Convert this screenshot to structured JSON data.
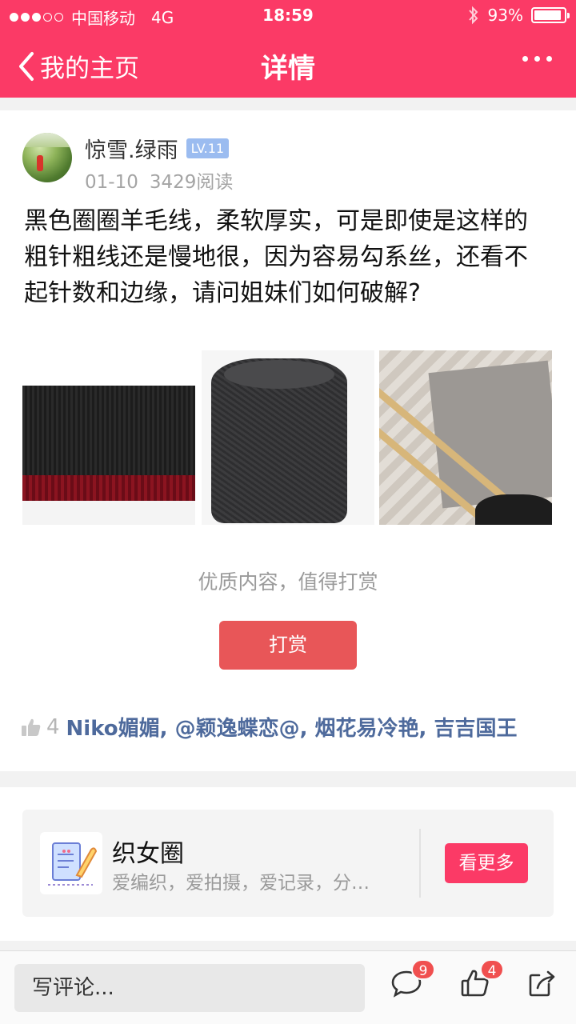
{
  "status_bar": {
    "carrier": "中国移动",
    "network": "4G",
    "time": "18:59",
    "battery": "93%",
    "battery_level": 0.93
  },
  "nav": {
    "back_label": "我的主页",
    "title": "详情"
  },
  "post": {
    "author": "惊雪.绿雨",
    "level": "LV.11",
    "date": "01-10",
    "reads": "3429阅读",
    "content": "黑色圈圈羊毛线，柔软厚实，可是即使是这样的粗针粗线还是慢地很，因为容易勾系丝，还看不起针数和边缘，请问姐妹们如何破解?",
    "reward_prompt": "优质内容，值得打赏",
    "reward_button": "打赏",
    "likes_count": "4",
    "likers": "Niko媚媚, @颖逸蝶恋@, 烟花易冷艳, 吉吉国王"
  },
  "circle": {
    "name": "织女圈",
    "description": "爱编织，爱拍摄，爱记录，分…",
    "more_button": "看更多"
  },
  "bottom_bar": {
    "comment_placeholder": "写评论...",
    "comments_badge": "9",
    "likes_badge": "4"
  },
  "colors": {
    "brand": "#fb3a66",
    "reward": "#e85658",
    "link": "#4e6a9c",
    "level_badge": "#9bbcf0"
  },
  "icons": [
    "back-chevron-icon",
    "more-dots-icon",
    "bluetooth-icon",
    "battery-icon",
    "thumbs-up-icon",
    "comment-icon",
    "like-icon",
    "share-icon"
  ]
}
